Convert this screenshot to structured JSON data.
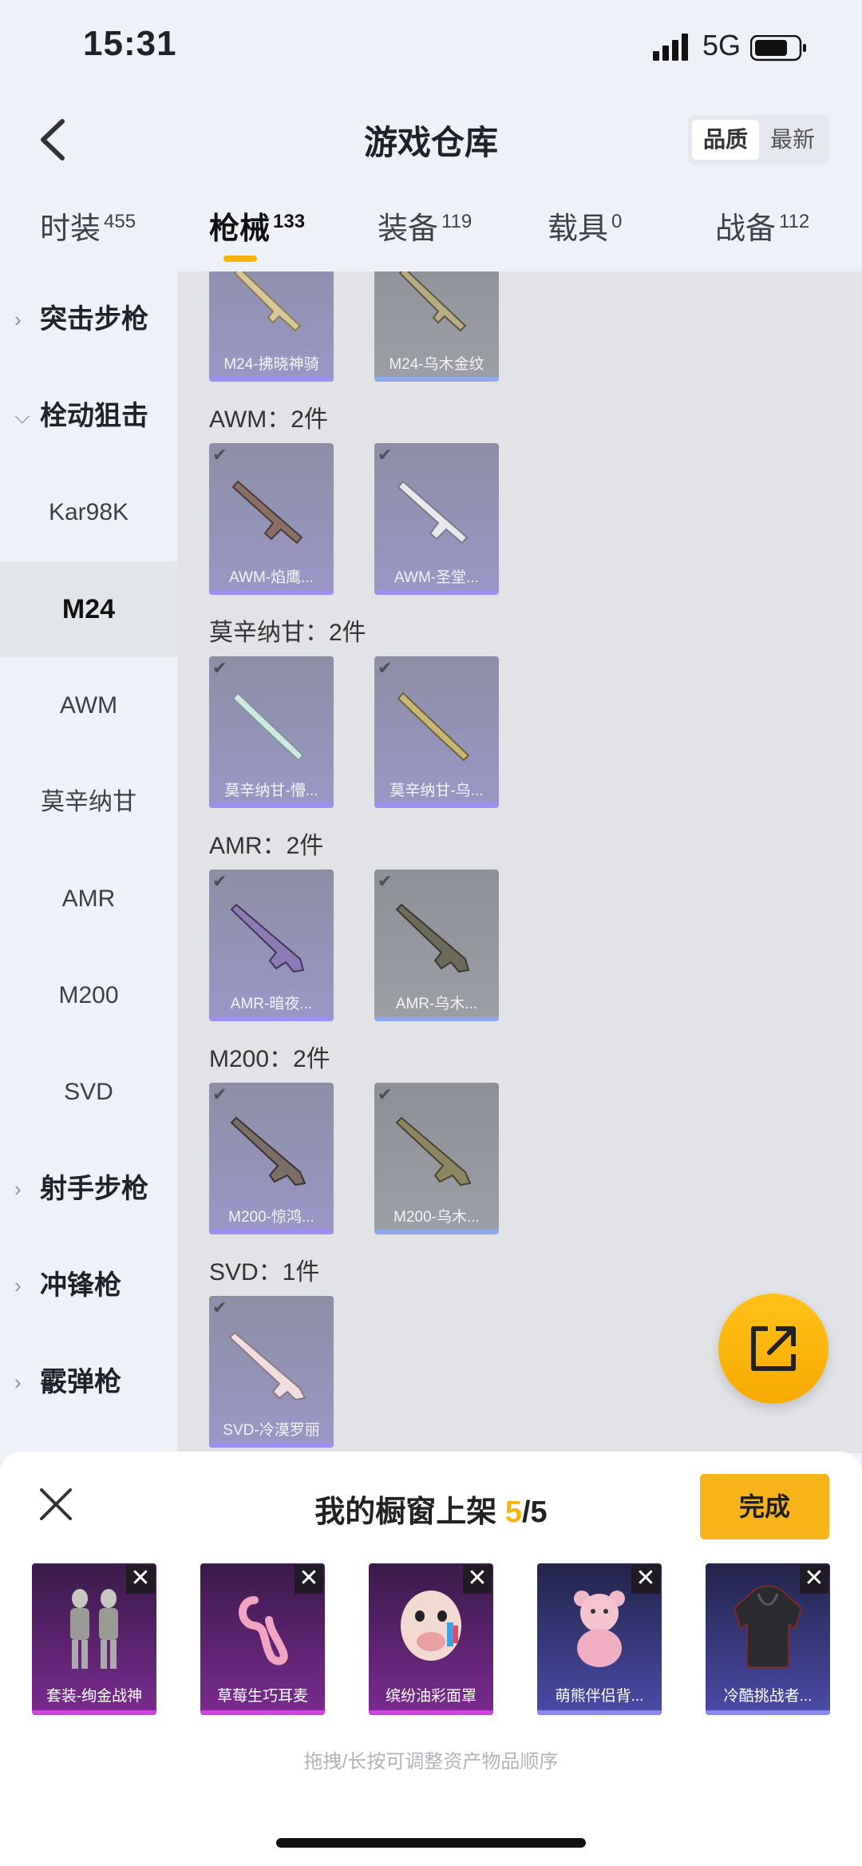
{
  "status": {
    "time": "15:31",
    "network": "5G"
  },
  "header": {
    "title": "游戏仓库",
    "sort_quality": "品质",
    "sort_latest": "最新"
  },
  "tabs": [
    {
      "label": "时装",
      "count": "455"
    },
    {
      "label": "枪械",
      "count": "133",
      "active": true
    },
    {
      "label": "装备",
      "count": "119"
    },
    {
      "label": "载具",
      "count": "0"
    },
    {
      "label": "战备",
      "count": "112"
    }
  ],
  "sidebar": [
    {
      "label": "突击步枪",
      "type": "category",
      "expanded": false
    },
    {
      "label": "栓动狙击",
      "type": "category",
      "expanded": true
    },
    {
      "label": "Kar98K",
      "type": "sub"
    },
    {
      "label": "M24",
      "type": "sub",
      "selected": true
    },
    {
      "label": "AWM",
      "type": "sub"
    },
    {
      "label": "莫辛纳甘",
      "type": "sub"
    },
    {
      "label": "AMR",
      "type": "sub"
    },
    {
      "label": "M200",
      "type": "sub"
    },
    {
      "label": "SVD",
      "type": "sub"
    },
    {
      "label": "射手步枪",
      "type": "category",
      "expanded": false
    },
    {
      "label": "冲锋枪",
      "type": "category",
      "expanded": false
    },
    {
      "label": "霰弹枪",
      "type": "category",
      "expanded": false
    }
  ],
  "groups": [
    {
      "heading": "",
      "items": [
        {
          "name": "M24-拂晓神骑",
          "tone": "purple"
        },
        {
          "name": "M24-乌木金纹",
          "tone": "gray"
        }
      ]
    },
    {
      "heading": "AWM：2件",
      "items": [
        {
          "name": "AWM-焰鹰...",
          "tone": "purple"
        },
        {
          "name": "AWM-圣堂...",
          "tone": "purple"
        }
      ]
    },
    {
      "heading": "莫辛纳甘：2件",
      "items": [
        {
          "name": "莫辛纳甘-懵...",
          "tone": "purple"
        },
        {
          "name": "莫辛纳甘-乌...",
          "tone": "purple"
        }
      ]
    },
    {
      "heading": "AMR：2件",
      "items": [
        {
          "name": "AMR-暗夜...",
          "tone": "purple"
        },
        {
          "name": "AMR-乌木...",
          "tone": "gray"
        }
      ]
    },
    {
      "heading": "M200：2件",
      "items": [
        {
          "name": "M200-惊鸿...",
          "tone": "purple"
        },
        {
          "name": "M200-乌木...",
          "tone": "gray"
        }
      ]
    },
    {
      "heading": "SVD：1件",
      "items": [
        {
          "name": "SVD-冷漠罗丽",
          "tone": "purple"
        }
      ]
    }
  ],
  "showcase": {
    "title_prefix": "我的橱窗上架 ",
    "count": "5",
    "total": "/5",
    "done_label": "完成",
    "hint": "拖拽/长按可调整资产物品顺序",
    "items": [
      {
        "name": "套装-绚金战神",
        "tone": "purple"
      },
      {
        "name": "草莓生巧耳麦",
        "tone": "purple"
      },
      {
        "name": "缤纷油彩面罩",
        "tone": "purple"
      },
      {
        "name": "萌熊伴侣背...",
        "tone": "blue"
      },
      {
        "name": "冷酷挑战者...",
        "tone": "blue"
      }
    ]
  },
  "colors": {
    "accent": "#f6b30a",
    "rarity_purple": "#9d8ff2",
    "rarity_blue": "#8ea8ee",
    "rarity_pink": "#d045e0"
  }
}
